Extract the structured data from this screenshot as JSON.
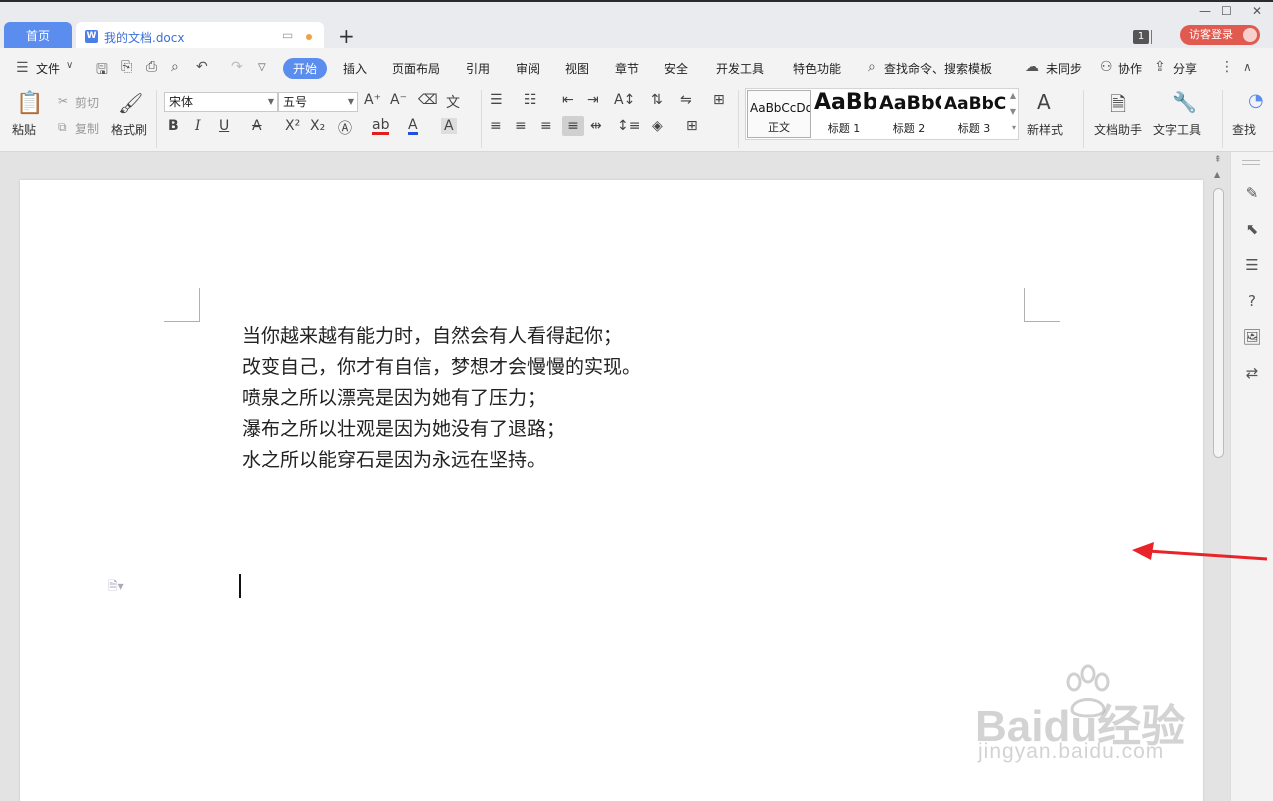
{
  "tabs": {
    "home": "首页",
    "doc": "我的文档.docx"
  },
  "titlebar": {
    "badge_count": "1",
    "login_label": "访客登录"
  },
  "menu": {
    "file": "文件",
    "items": [
      "开始",
      "插入",
      "页面布局",
      "引用",
      "审阅",
      "视图",
      "章节",
      "安全",
      "开发工具",
      "特色功能"
    ],
    "search": "查找命令、搜索模板",
    "sync": "未同步",
    "collab": "协作",
    "share": "分享"
  },
  "ribbon": {
    "paste": "粘贴",
    "cut": "剪切",
    "copy": "复制",
    "format_painter": "格式刷",
    "font_name": "宋体",
    "font_size": "五号",
    "styles": [
      {
        "sample": "AaBbCcDd",
        "name": "正文"
      },
      {
        "sample": "AaBb",
        "name": "标题 1"
      },
      {
        "sample": "AaBbC",
        "name": "标题 2"
      },
      {
        "sample": "AaBbCc",
        "name": "标题 3"
      }
    ],
    "new_style": "新样式",
    "doc_helper": "文档助手",
    "text_tools": "文字工具",
    "find": "查找"
  },
  "document": {
    "lines": [
      "当你越来越有能力时，自然会有人看得起你；",
      "改变自己，你才有自信，梦想才会慢慢的实现。",
      "喷泉之所以漂亮是因为她有了压力；",
      "瀑布之所以壮观是因为她没有了退路；",
      "水之所以能穿石是因为永远在坚持。"
    ]
  },
  "watermark": {
    "brand": "Baidu经验",
    "url": "jingyan.baidu.com"
  },
  "colors": {
    "accent": "#5b8def",
    "login": "#e05a50",
    "arrow": "#e8232a"
  }
}
